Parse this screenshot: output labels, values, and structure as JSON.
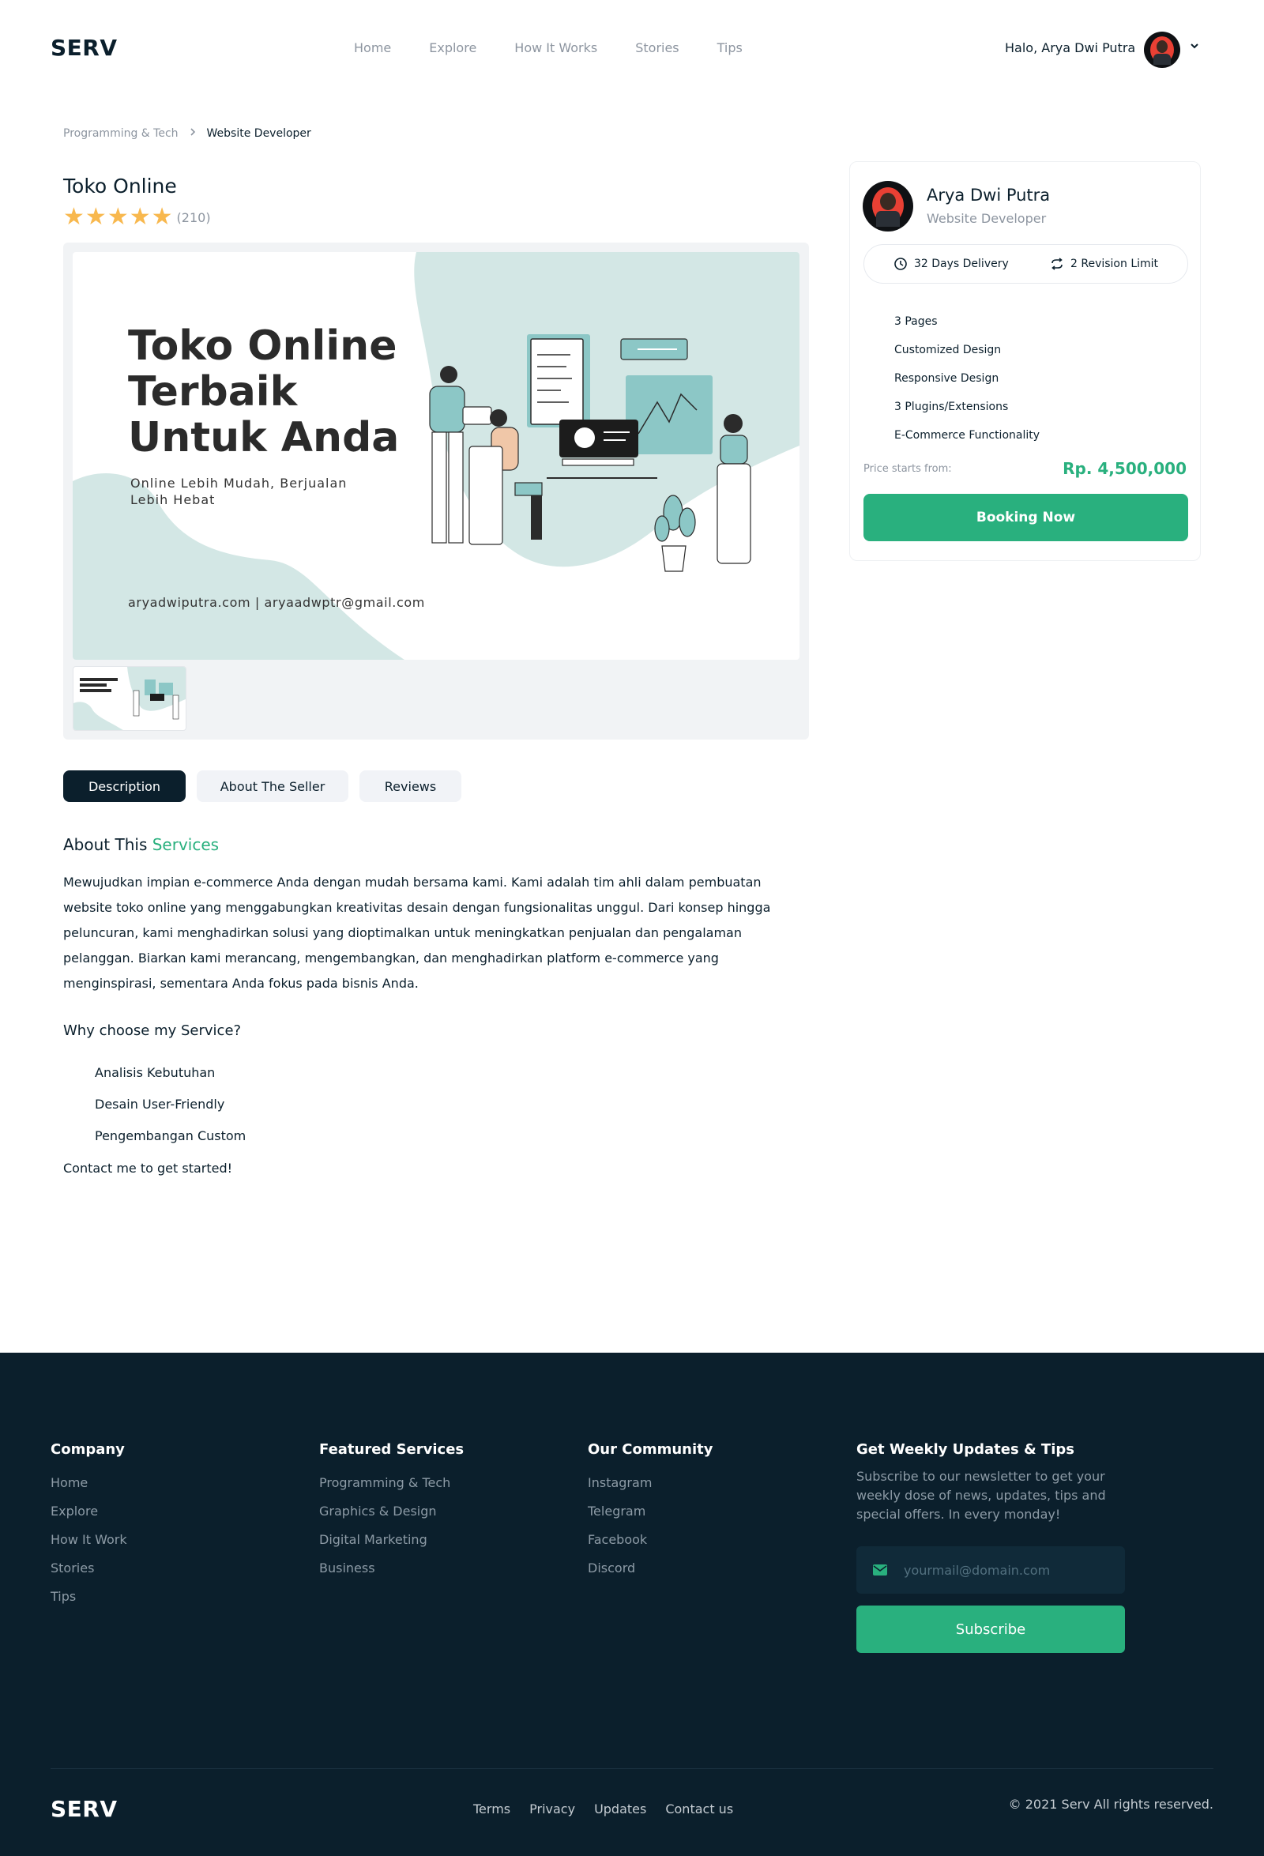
{
  "brand": "SERV",
  "nav": [
    "Home",
    "Explore",
    "How It Works",
    "Stories",
    "Tips"
  ],
  "user": {
    "greeting": "Halo, Arya Dwi Putra"
  },
  "breadcrumb": {
    "parent": "Programming & Tech",
    "current": "Website Developer"
  },
  "service": {
    "title": "Toko Online",
    "rating": 5,
    "review_count": "(210)",
    "hero_title": "Toko Online\nTerbaik\nUntuk Anda",
    "hero_subtitle": "Online Lebih Mudah, Berjualan\nLebih Hebat",
    "hero_contact": "aryadwiputra.com | aryaadwptr@gmail.com"
  },
  "tabs": [
    "Description",
    "About The Seller",
    "Reviews"
  ],
  "description": {
    "heading_prefix": "About This",
    "heading_accent": "Services",
    "body": "Mewujudkan impian e-commerce Anda dengan mudah bersama kami. Kami adalah tim ahli dalam pembuatan website toko online yang menggabungkan kreativitas desain dengan fungsionalitas unggul. Dari konsep hingga peluncuran, kami menghadirkan solusi yang dioptimalkan untuk meningkatkan penjualan dan pengalaman pelanggan. Biarkan kami merancang, mengembangkan, dan menghadirkan platform e-commerce yang menginspirasi, sementara Anda fokus pada bisnis Anda.",
    "why_heading": "Why choose my Service?",
    "why_items": [
      "Analisis Kebutuhan",
      "Desain User-Friendly",
      "Pengembangan Custom"
    ],
    "contact_line": "Contact me to get started!"
  },
  "seller_card": {
    "name": "Arya Dwi Putra",
    "role": "Website Developer",
    "delivery": "32 Days Delivery",
    "revision": "2 Revision Limit",
    "features": [
      "3 Pages",
      "Customized Design",
      "Responsive Design",
      "3 Plugins/Extensions",
      "E-Commerce Functionality"
    ],
    "price_label": "Price starts from:",
    "price": "Rp. 4,500,000",
    "cta": "Booking Now"
  },
  "footer": {
    "company": {
      "title": "Company",
      "links": [
        "Home",
        "Explore",
        "How It Work",
        "Stories",
        "Tips"
      ]
    },
    "featured": {
      "title": "Featured Services",
      "links": [
        "Programming & Tech",
        "Graphics & Design",
        "Digital Marketing",
        "Business"
      ]
    },
    "community": {
      "title": "Our Community",
      "links": [
        "Instagram",
        "Telegram",
        "Facebook",
        "Discord"
      ]
    },
    "newsletter": {
      "title": "Get Weekly Updates & Tips",
      "text": "Subscribe to our newsletter to get your weekly dose of news, updates, tips and special offers. In every monday!",
      "placeholder": "yourmail@domain.com",
      "button": "Subscribe"
    },
    "bottom_links": [
      "Terms",
      "Privacy",
      "Updates",
      "Contact us"
    ],
    "copyright": "© 2021 Serv All rights reserved."
  },
  "colors": {
    "primary": "#29b07e",
    "dark": "#0b1f2c",
    "star": "#f8b84e",
    "muted": "#8d95a0",
    "hero_teal": "#d3e7e5"
  },
  "icons": [
    "avatar",
    "chevron-down-icon",
    "chevron-right-icon",
    "star-icon",
    "clock-icon",
    "repeat-icon",
    "mail-icon"
  ]
}
